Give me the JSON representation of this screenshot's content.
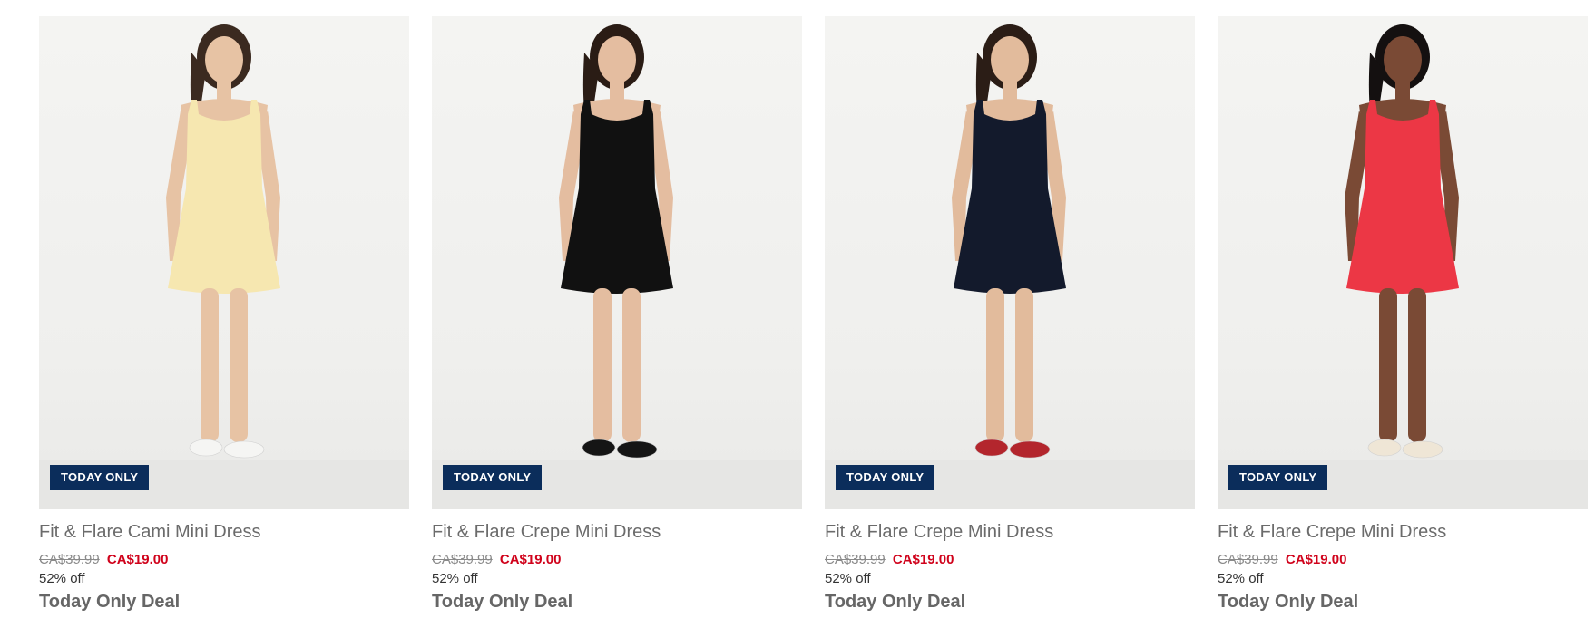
{
  "products": [
    {
      "name": "Fit & Flare Cami Mini Dress",
      "badge": "TODAY ONLY",
      "original_price": "CA$39.99",
      "sale_price": "CA$19.00",
      "discount": "52% off",
      "promo": "Today Only Deal",
      "dress_color": "#f6e7b0",
      "skin_color": "#e7c3a4",
      "hair_color": "#3b2a20",
      "shoe_color": "#f5f5f3"
    },
    {
      "name": "Fit & Flare Crepe Mini Dress",
      "badge": "TODAY ONLY",
      "original_price": "CA$39.99",
      "sale_price": "CA$19.00",
      "discount": "52% off",
      "promo": "Today Only Deal",
      "dress_color": "#111111",
      "skin_color": "#e4bda0",
      "hair_color": "#2a1c15",
      "shoe_color": "#151515"
    },
    {
      "name": "Fit & Flare Crepe Mini Dress",
      "badge": "TODAY ONLY",
      "original_price": "CA$39.99",
      "sale_price": "CA$19.00",
      "discount": "52% off",
      "promo": "Today Only Deal",
      "dress_color": "#131a2c",
      "skin_color": "#e2bb9c",
      "hair_color": "#2b1d16",
      "shoe_color": "#b3262d"
    },
    {
      "name": "Fit & Flare Crepe Mini Dress",
      "badge": "TODAY ONLY",
      "original_price": "CA$39.99",
      "sale_price": "CA$19.00",
      "discount": "52% off",
      "promo": "Today Only Deal",
      "dress_color": "#ec3745",
      "skin_color": "#7a4a35",
      "hair_color": "#141010",
      "shoe_color": "#efe6d6"
    }
  ]
}
